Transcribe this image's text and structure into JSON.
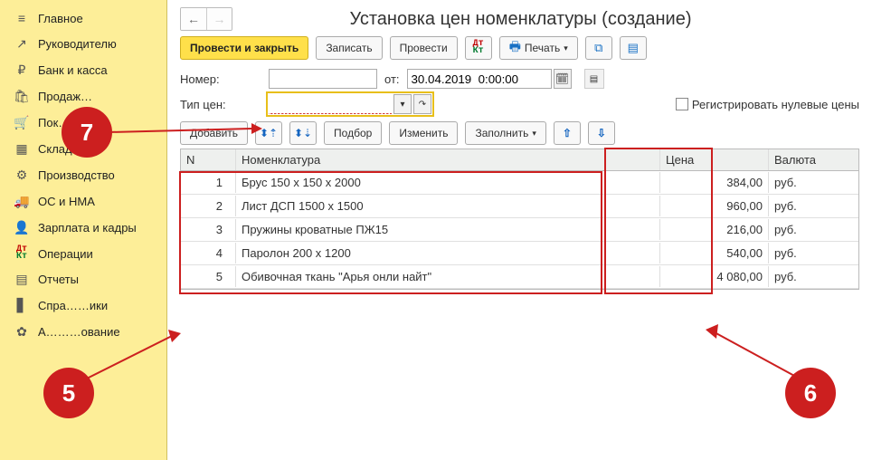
{
  "sidebar": {
    "items": [
      {
        "icon": "≡",
        "label": "Главное"
      },
      {
        "icon": "↗",
        "label": "Руководителю"
      },
      {
        "icon": "₽",
        "label": "Банк и касса"
      },
      {
        "icon": "🛍",
        "label": "Продаж…"
      },
      {
        "icon": "🛒",
        "label": "Пок…"
      },
      {
        "icon": "▦",
        "label": "Склад"
      },
      {
        "icon": "⚙",
        "label": "Производство"
      },
      {
        "icon": "🚚",
        "label": "ОС и НМА"
      },
      {
        "icon": "👤",
        "label": "Зарплата и кадры"
      },
      {
        "icon": "ДтКт",
        "label": "Операции"
      },
      {
        "icon": "▤",
        "label": "Отчеты"
      },
      {
        "icon": "▋",
        "label": "Спра……ики"
      },
      {
        "icon": "✿",
        "label": "А………ование"
      }
    ]
  },
  "header": {
    "title": "Установка цен номенклатуры (создание)",
    "buttons": {
      "post_close": "Провести и закрыть",
      "save": "Записать",
      "post": "Провести",
      "print": "Печать"
    }
  },
  "form": {
    "number_label": "Номер:",
    "number_value": "",
    "from_label": "от:",
    "date_value": "30.04.2019  0:00:00",
    "price_type_label": "Тип цен:",
    "reg_zero_label": "Регистрировать нулевые цены"
  },
  "toolbar": {
    "add": "Добавить",
    "match": "Подбор",
    "change": "Изменить",
    "fill": "Заполнить"
  },
  "table": {
    "columns": {
      "n": "N",
      "name": "Номенклатура",
      "price": "Цена",
      "curr": "Валюта"
    },
    "rows": [
      {
        "n": "1",
        "name": "Брус 150 х 150 х 2000",
        "price": "384,00",
        "curr": "руб."
      },
      {
        "n": "2",
        "name": "Лист ДСП 1500 х 1500",
        "price": "960,00",
        "curr": "руб."
      },
      {
        "n": "3",
        "name": "Пружины кроватные ПЖ15",
        "price": "216,00",
        "curr": "руб."
      },
      {
        "n": "4",
        "name": "Паролон 200 х 1200",
        "price": "540,00",
        "curr": "руб."
      },
      {
        "n": "5",
        "name": "Обивочная ткань \"Арья онли найт\"",
        "price": "4 080,00",
        "curr": "руб."
      }
    ]
  },
  "callouts": {
    "c5": "5",
    "c6": "6",
    "c7": "7"
  }
}
